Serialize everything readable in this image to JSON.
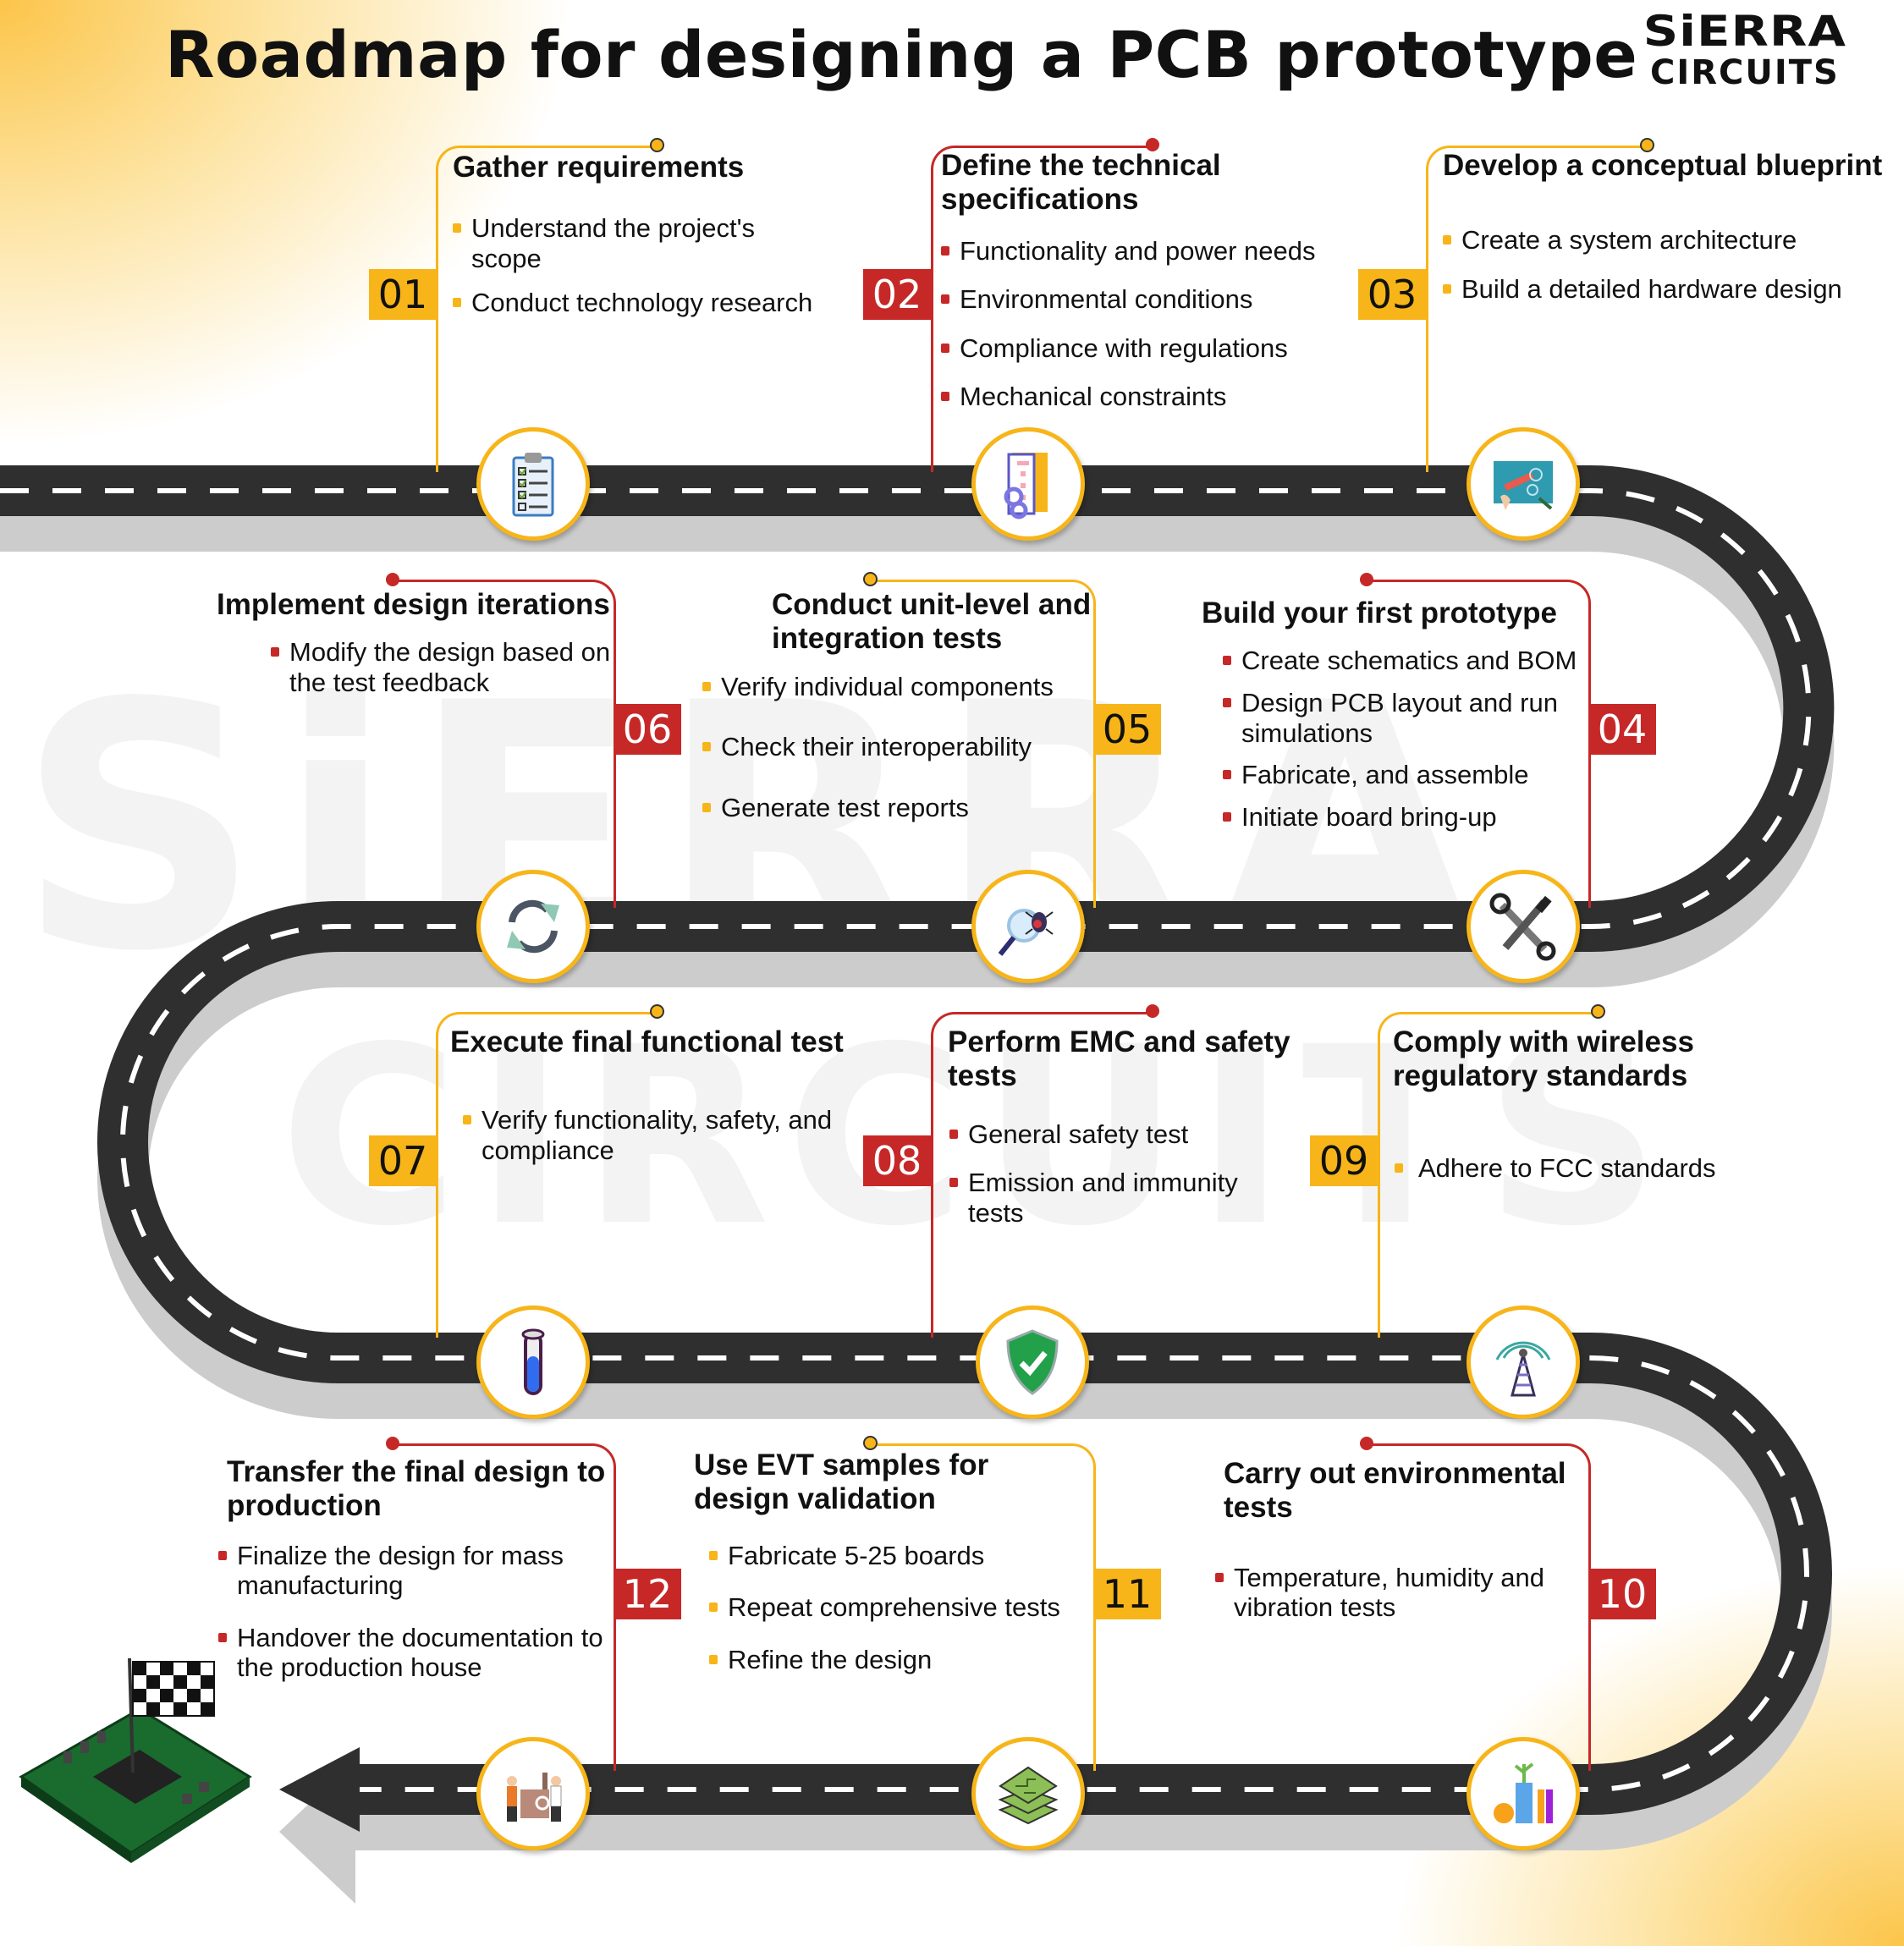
{
  "title": "Roadmap for designing a PCB prototype",
  "brand": {
    "line1": "SiERRA",
    "line2": "CIRCUITS"
  },
  "watermark": {
    "line1": "SiERRA",
    "line2": "CIRCUITS"
  },
  "colors": {
    "accent_yellow": "#f7b519",
    "accent_red": "#c62828",
    "road": "#2f2f2f",
    "road_shadow": "#cccccc"
  },
  "steps": [
    {
      "number": "01",
      "color": "yellow",
      "title": "Gather requirements",
      "bullets": [
        "Understand the project's scope",
        "Conduct technology research"
      ],
      "icon": "clipboard-checklist-icon"
    },
    {
      "number": "02",
      "color": "red",
      "title": "Define the technical specifications",
      "bullets": [
        "Functionality and power needs",
        "Environmental conditions",
        "Compliance with regulations",
        "Mechanical constraints"
      ],
      "icon": "specification-document-gears-icon"
    },
    {
      "number": "03",
      "color": "yellow",
      "title": "Develop a conceptual blueprint",
      "bullets": [
        "Create a system architecture",
        "Build a detailed hardware design"
      ],
      "icon": "blueprint-drawing-icon"
    },
    {
      "number": "04",
      "color": "red",
      "title": "Build your first prototype",
      "bullets": [
        "Create schematics and BOM",
        "Design PCB layout and run simulations",
        "Fabricate, and assemble",
        "Initiate board bring-up"
      ],
      "icon": "wrench-screwdriver-icon"
    },
    {
      "number": "05",
      "color": "yellow",
      "title": "Conduct unit-level and integration tests",
      "bullets": [
        "Verify individual components",
        "Check their interoperability",
        "Generate test reports"
      ],
      "icon": "magnifier-bug-icon"
    },
    {
      "number": "06",
      "color": "red",
      "title": "Implement design iterations",
      "bullets": [
        "Modify the design based on the test feedback"
      ],
      "icon": "refresh-cycle-icon"
    },
    {
      "number": "07",
      "color": "yellow",
      "title": "Execute final functional test",
      "bullets": [
        "Verify functionality, safety, and compliance"
      ],
      "icon": "test-tube-icon"
    },
    {
      "number": "08",
      "color": "red",
      "title": "Perform EMC and safety tests",
      "bullets": [
        "General safety test",
        "Emission and immunity tests"
      ],
      "icon": "shield-check-icon"
    },
    {
      "number": "09",
      "color": "yellow",
      "title": "Comply with wireless regulatory standards",
      "bullets": [
        "Adhere to FCC standards"
      ],
      "icon": "radio-tower-icon"
    },
    {
      "number": "10",
      "color": "red",
      "title": "Carry out environmental tests",
      "bullets": [
        "Temperature, humidity and vibration tests"
      ],
      "icon": "lab-plants-icon"
    },
    {
      "number": "11",
      "color": "yellow",
      "title": "Use EVT samples for design validation",
      "bullets": [
        "Fabricate 5-25 boards",
        "Repeat comprehensive tests",
        "Refine the design"
      ],
      "icon": "pcb-layers-icon"
    },
    {
      "number": "12",
      "color": "red",
      "title": "Transfer the final design to production",
      "bullets": [
        "Finalize the design for mass manufacturing",
        "Handover the documentation to the production house"
      ],
      "icon": "factory-workers-icon"
    }
  ],
  "finish": {
    "icon": "pcb-checkered-flag-icon"
  }
}
